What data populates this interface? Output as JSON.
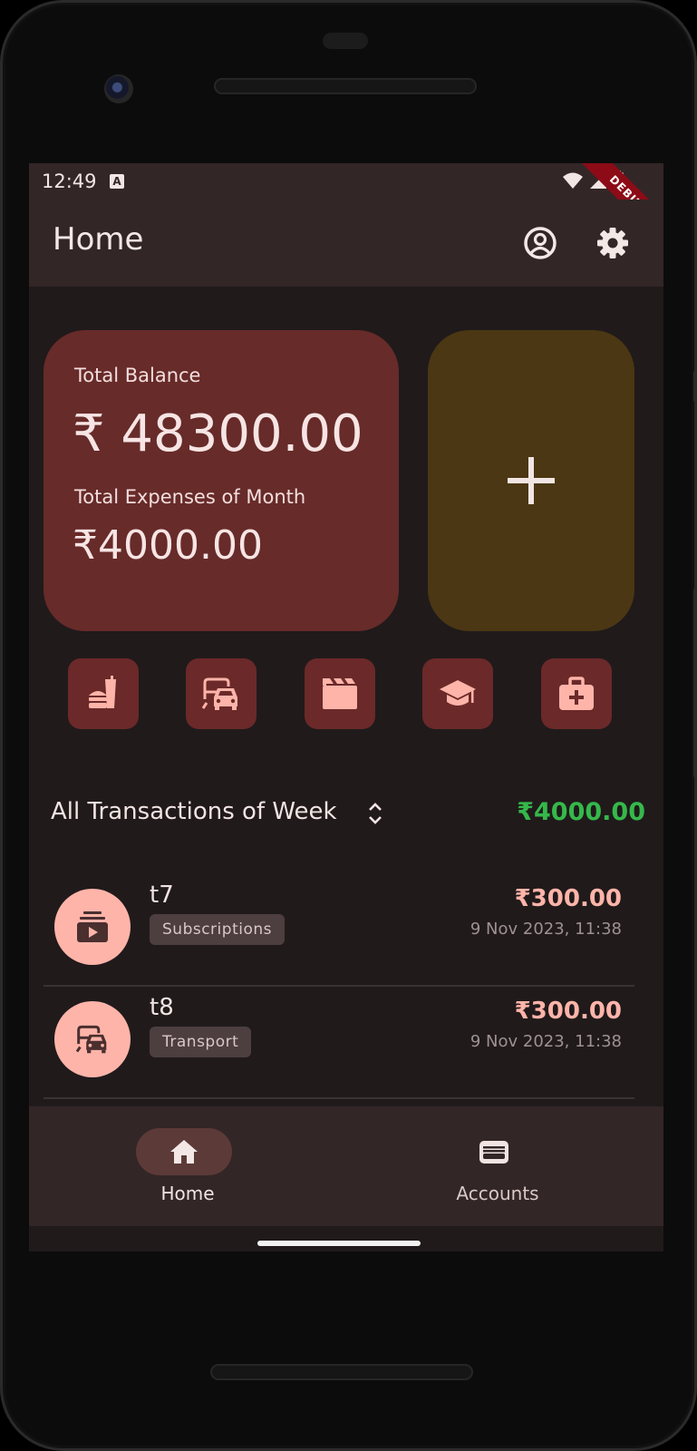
{
  "status_bar": {
    "time": "12:49",
    "notification_icon": "A",
    "debug_label": "DEBUG"
  },
  "app_bar": {
    "title": "Home",
    "profile_icon": "account-circle-icon",
    "settings_icon": "gear-icon"
  },
  "balance_card": {
    "balance_label": "Total Balance",
    "balance_value": "₹ 48300.00",
    "expense_label": "Total Expenses of Month",
    "expense_value": "₹4000.00"
  },
  "add_card": {
    "icon": "plus-icon"
  },
  "categories": [
    {
      "name": "food",
      "icon": "fastfood-icon"
    },
    {
      "name": "transport",
      "icon": "commute-icon"
    },
    {
      "name": "entertainment",
      "icon": "clapperboard-icon"
    },
    {
      "name": "education",
      "icon": "graduation-cap-icon"
    },
    {
      "name": "medical",
      "icon": "medical-bag-icon"
    }
  ],
  "transactions": {
    "header": "All Transactions of Week",
    "total": "₹4000.00",
    "items": [
      {
        "name": "t7",
        "category": "Subscriptions",
        "amount": "₹300.00",
        "date": "9 Nov 2023, 11:38",
        "icon": "subscriptions-icon"
      },
      {
        "name": "t8",
        "category": "Transport",
        "amount": "₹300.00",
        "date": "9 Nov 2023, 11:38",
        "icon": "commute-icon"
      }
    ]
  },
  "bottom_nav": {
    "items": [
      {
        "label": "Home",
        "active": true,
        "icon": "home-icon"
      },
      {
        "label": "Accounts",
        "active": false,
        "icon": "wallet-icon"
      }
    ]
  },
  "colors": {
    "background": "#201a1b",
    "surface": "#332627",
    "balance_card": "#672b29",
    "add_card": "#4b3713",
    "accent": "#ffb4a9",
    "positive": "#35b84a"
  }
}
